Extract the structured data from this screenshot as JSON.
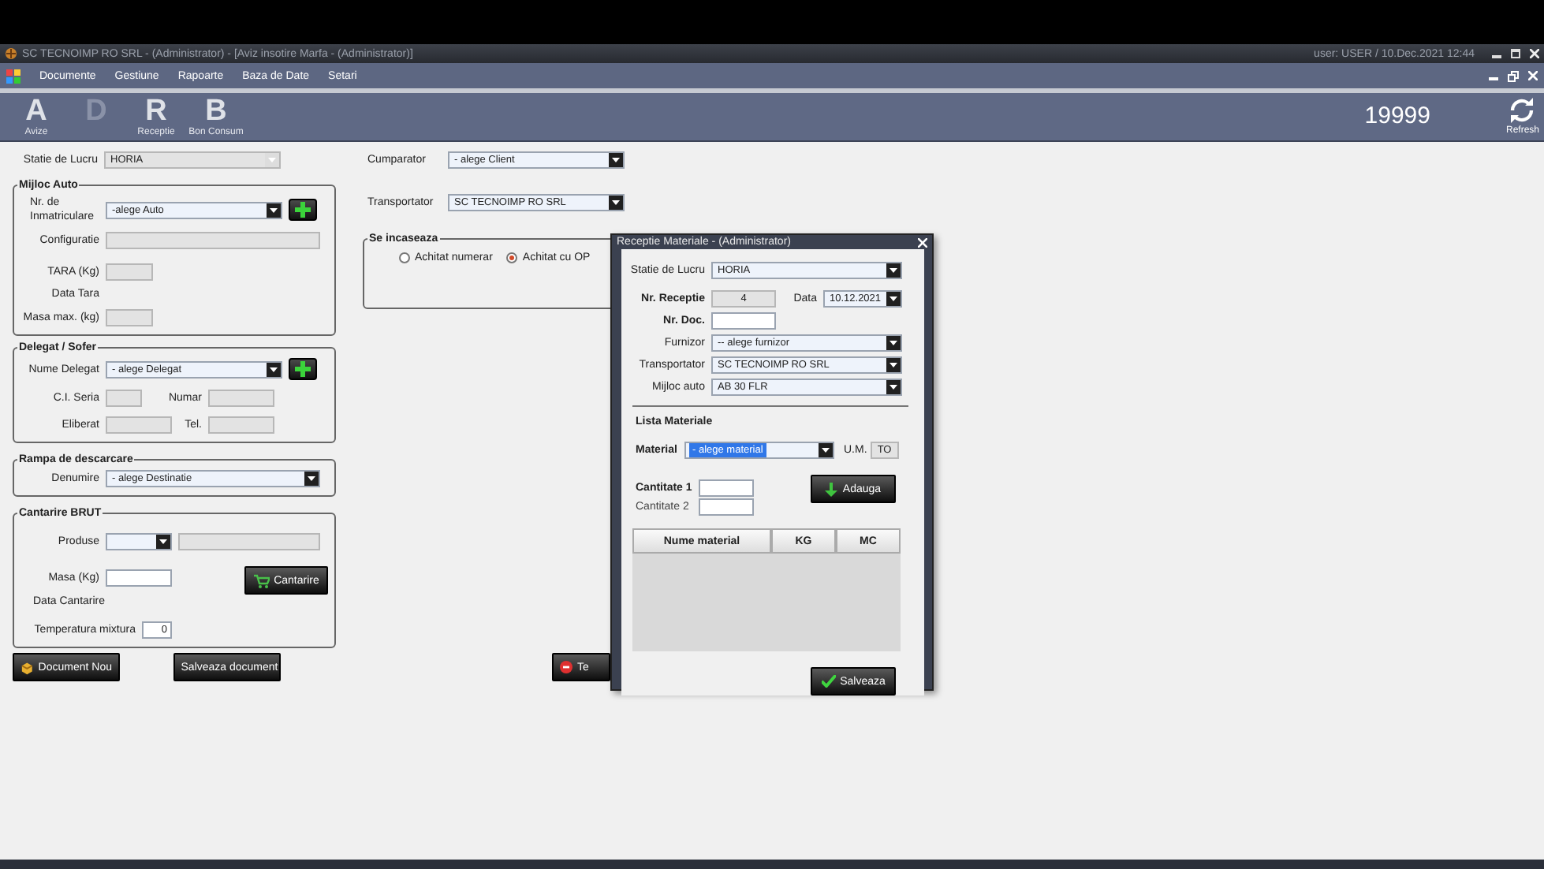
{
  "title_bar": {
    "title": "SC TECNOIMP RO SRL - (Administrator) - [Aviz insotire Marfa - (Administrator)]",
    "user_info": "user: USER / 10.Dec.2021 12:44"
  },
  "menu": [
    {
      "label": "Documente"
    },
    {
      "label": "Gestiune"
    },
    {
      "label": "Rapoarte"
    },
    {
      "label": "Baza de Date"
    },
    {
      "label": "Setari"
    }
  ],
  "toolbar": {
    "items": [
      {
        "letter": "A",
        "label": "Avize",
        "disabled": false
      },
      {
        "letter": "D",
        "disabled": true
      },
      {
        "letter": "R",
        "label": "Receptie",
        "disabled": false
      },
      {
        "letter": "B",
        "label": "Bon Consum",
        "disabled": false
      }
    ],
    "document_number": "19999",
    "refresh_label": "Refresh"
  },
  "left": {
    "statie": {
      "label": "Statie de Lucru",
      "kind": "combo",
      "value": "HORIA",
      "disabled": true
    },
    "mijloc_auto": {
      "title": "Mijloc Auto",
      "nr_inmatriculare": {
        "label": "Nr. de Inmatriculare",
        "kind": "combo",
        "value": "-alege Auto",
        "disabled": false
      },
      "configuratie": {
        "label": "Configuratie",
        "kind": "text",
        "disabled": true
      },
      "tara": {
        "label": "TARA (Kg)",
        "kind": "text",
        "disabled": true
      },
      "data_tara_label": "Data Tara",
      "masa_max": {
        "label": "Masa max. (kg)",
        "kind": "text",
        "disabled": true
      }
    },
    "delegat": {
      "title": "Delegat / Sofer",
      "nume": {
        "label": "Nume Delegat",
        "kind": "combo",
        "value": "- alege Delegat",
        "disabled": false
      },
      "ci_seria": {
        "label": "C.I. Seria",
        "kind": "text",
        "disabled": true
      },
      "numar": {
        "label": "Numar",
        "kind": "text",
        "disabled": true
      },
      "eliberat": {
        "label": "Eliberat",
        "kind": "text",
        "disabled": true
      },
      "tel": {
        "label": "Tel.",
        "kind": "text",
        "disabled": true
      }
    },
    "rampa": {
      "title": "Rampa de descarcare",
      "denumire": {
        "label": "Denumire",
        "kind": "combo",
        "value": "- alege Destinatie",
        "disabled": false
      }
    },
    "cantarire": {
      "title": "Cantarire BRUT",
      "produse": {
        "label": "Produse",
        "kind": "combo",
        "disabled": false
      },
      "produse_detail": {
        "kind": "text",
        "disabled": true
      },
      "masa": {
        "label": "Masa (Kg)",
        "kind": "text",
        "disabled": false
      },
      "button": "Cantarire",
      "data_cantarire_label": "Data Cantarire",
      "temperatura": {
        "label": "Temperatura mixtura",
        "kind": "text",
        "value": "0",
        "disabled": false
      }
    }
  },
  "buttons": [
    {
      "label": "Document Nou",
      "kind": "new"
    },
    {
      "label": "Salveaza document",
      "kind": "save"
    },
    {
      "label": "Te",
      "kind": "cancel"
    }
  ],
  "middle": {
    "cumparator": {
      "label": "Cumparator",
      "kind": "combo",
      "value": "- alege Client",
      "disabled": false
    },
    "transportator": {
      "label": "Transportator",
      "kind": "combo",
      "value": "SC TECNOIMP RO SRL",
      "disabled": false
    },
    "incasare": {
      "title": "Se incaseaza",
      "options": [
        {
          "label": "Achitat numerar",
          "selected": false
        },
        {
          "label": "Achitat cu OP",
          "selected": true
        }
      ]
    }
  },
  "dialog": {
    "title": "Receptie Materiale - (Administrator)",
    "statie": {
      "label": "Statie de Lucru",
      "kind": "combo",
      "value": "HORIA",
      "disabled": false
    },
    "nr_receptie": {
      "label": "Nr. Receptie",
      "kind": "text",
      "value": "4",
      "disabled": true
    },
    "data": {
      "label": "Data",
      "kind": "combo",
      "value": "10.12.2021",
      "disabled": false
    },
    "nr_doc": {
      "label": "Nr. Doc.",
      "kind": "text",
      "disabled": false
    },
    "furnizor": {
      "label": "Furnizor",
      "kind": "combo",
      "value": "-- alege furnizor",
      "disabled": false
    },
    "transportator": {
      "label": "Transportator",
      "kind": "combo",
      "value": "SC TECNOIMP RO SRL",
      "disabled": false
    },
    "mijloc_auto": {
      "label": "Mijloc auto",
      "kind": "combo",
      "value": "AB 30 FLR",
      "disabled": false
    },
    "lista_title": "Lista Materiale",
    "material": {
      "label": "Material",
      "kind": "combo",
      "value": "- alege material",
      "highlighted": true,
      "disabled": false
    },
    "um": {
      "label": "U.M.",
      "kind": "text",
      "value": "TO",
      "disabled": true
    },
    "cantitate1": {
      "label": "Cantitate 1",
      "kind": "text",
      "disabled": false
    },
    "cantitate2": {
      "label": "Cantitate 2",
      "kind": "text",
      "disabled": false
    },
    "add_button": "Adauga",
    "table": {
      "columns": [
        "Nume material",
        "KG",
        "MC"
      ]
    },
    "save_button": "Salveaza"
  }
}
